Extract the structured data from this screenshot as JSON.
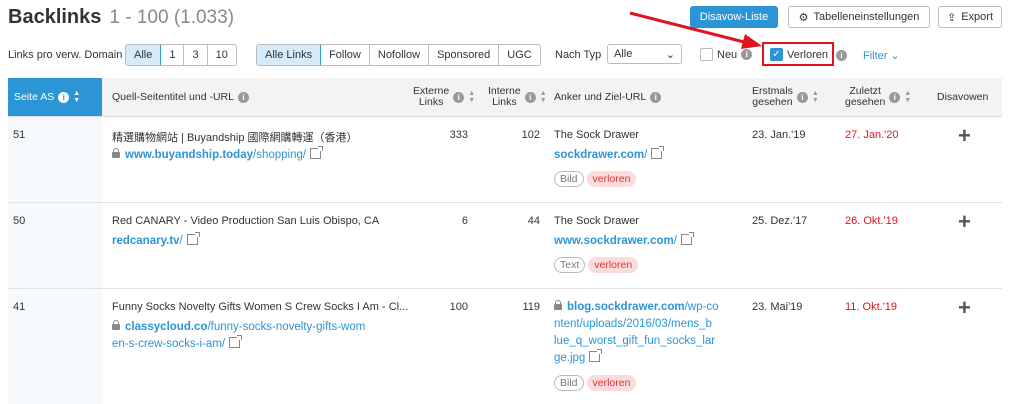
{
  "header": {
    "title": "Backlinks",
    "range": "1 - 100 (1.033)",
    "disavow_button": "Disavow-Liste",
    "table_settings_button": "Tabelleneinstellungen",
    "export_button": "Export"
  },
  "filters": {
    "links_per_domain_label": "Links pro verw. Domain",
    "per_domain_options": [
      "Alle",
      "1",
      "3",
      "10"
    ],
    "link_type_options": [
      "Alle Links",
      "Follow",
      "Nofollow",
      "Sponsored",
      "UGC"
    ],
    "by_type_label": "Nach Typ",
    "by_type_value": "Alle",
    "new_label": "Neu",
    "lost_label": "Verloren",
    "filter_link": "Filter"
  },
  "table": {
    "headers": {
      "page_as": "Seite AS",
      "source_title": "Quell-Seitentitel und -URL",
      "external_1": "Externe",
      "external_2": "Links",
      "internal_1": "Interne",
      "internal_2": "Links",
      "anchor": "Anker und Ziel-URL",
      "first_seen_1": "Erstmals",
      "first_seen_2": "gesehen",
      "last_seen_1": "Zuletzt",
      "last_seen_2": "gesehen",
      "disavow": "Disavowen"
    },
    "rows": [
      {
        "as": "51",
        "title": "精選購物網站 | Buyandship 國際網購轉運（香港）",
        "url_domain": "www.buyandship.today",
        "url_path": "/shopping/",
        "external": "333",
        "internal": "102",
        "anchor": "The Sock Drawer",
        "target_domain": "sockdrawer.com",
        "target_path": "/",
        "tag1": "Bild",
        "tag2": "verloren",
        "first_seen": "23. Jan.'19",
        "last_seen": "27. Jan.'20"
      },
      {
        "as": "50",
        "title": "Red CANARY - Video Production San Luis Obispo, CA",
        "url_domain": "redcanary.tv",
        "url_path": "/",
        "external": "6",
        "internal": "44",
        "anchor": "The Sock Drawer",
        "target_domain": "www.sockdrawer.com",
        "target_path": "/",
        "tag1": "Text",
        "tag2": "verloren",
        "first_seen": "25. Dez.'17",
        "last_seen": "26. Okt.'19"
      },
      {
        "as": "41",
        "title": "Funny Socks Novelty Gifts Women S Crew Socks I Am - Cl...",
        "url_domain": "classycloud.co",
        "url_path_1": "/funny-socks-novelty-gifts-wom",
        "url_path_2": "en-s-crew-socks-i-am/",
        "external": "100",
        "internal": "119",
        "target_domain": "blog.sockdrawer.com",
        "target_path_1": "/wp-co",
        "target_path_2": "ntent/uploads/2016/03/mens_b",
        "target_path_3": "lue_q_worst_gift_fun_socks_lar",
        "target_path_4": "ge.jpg",
        "tag1": "Bild",
        "tag2": "verloren",
        "first_seen": "23. Mai'19",
        "last_seen": "11. Okt.'19"
      }
    ]
  },
  "colors": {
    "accent": "#2b95d6",
    "lost": "#e0141e",
    "annotation": "#e0141e"
  }
}
